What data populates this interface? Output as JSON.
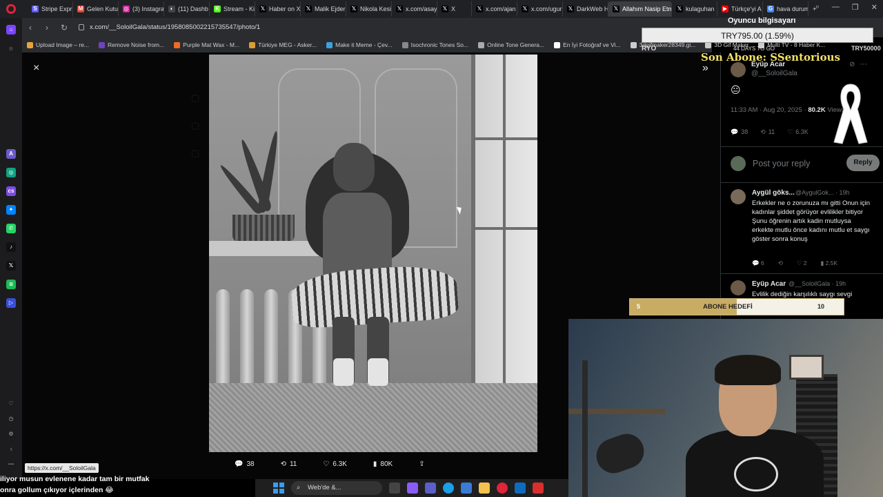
{
  "browser": {
    "tabs": [
      {
        "label": "Stripe Expr",
        "color": "#635bff",
        "glyph": "S"
      },
      {
        "label": "Gelen Kutu",
        "color": "#ea4335",
        "glyph": "M"
      },
      {
        "label": "(3) Instagra",
        "color": "#d6249f",
        "glyph": "◎"
      },
      {
        "label": "(11) Dashb",
        "color": "#444444",
        "glyph": "◐"
      },
      {
        "label": "Stream - Ki",
        "color": "#53fc18",
        "glyph": "K"
      },
      {
        "label": "Haber on X",
        "color": "#000000",
        "glyph": "𝕏"
      },
      {
        "label": "Malik Ejder",
        "color": "#000000",
        "glyph": "𝕏"
      },
      {
        "label": "Nikola Kesi",
        "color": "#000000",
        "glyph": "𝕏"
      },
      {
        "label": "x.com/asay",
        "color": "#000000",
        "glyph": "𝕏"
      },
      {
        "label": "X",
        "color": "#000000",
        "glyph": "𝕏"
      },
      {
        "label": "x.com/ajan",
        "color": "#000000",
        "glyph": "𝕏"
      },
      {
        "label": "x.com/ugur",
        "color": "#000000",
        "glyph": "𝕏"
      },
      {
        "label": "DarkWeb H",
        "color": "#000000",
        "glyph": "𝕏"
      },
      {
        "label": "Allahım Nasip Etme",
        "color": "#000000",
        "glyph": "𝕏",
        "active": true
      },
      {
        "label": "kulaguhan",
        "color": "#000000",
        "glyph": "𝕏"
      },
      {
        "label": "Türkçe'yi A",
        "color": "#ff0000",
        "glyph": "▶"
      },
      {
        "label": "hava durum",
        "color": "#4285f4",
        "glyph": "G"
      }
    ],
    "new_tab_label": "+",
    "url": "x.com/__SoloilGala/status/1958085002215735547/photo/1",
    "bookmarks": [
      {
        "label": "Upload Image – re...",
        "color": "#e8a33a"
      },
      {
        "label": "Remove Noise from...",
        "color": "#6f42c1"
      },
      {
        "label": "Purple Mat Wax - M...",
        "color": "#f06a24"
      },
      {
        "label": "Türkiye MEG - Asker...",
        "color": "#d9a036"
      },
      {
        "label": "Make it Meme - Çev...",
        "color": "#3aa2e0"
      },
      {
        "label": "Isochronic Tones So...",
        "color": "#888888"
      },
      {
        "label": "Online Tone Genera...",
        "color": "#aaaaaa"
      },
      {
        "label": "En İyi Fotoğraf ve Vi...",
        "color": "#ffffff"
      },
      {
        "label": "3dgifmaker28349.gi...",
        "color": "#cccccc"
      },
      {
        "label": "3D Gif Maker",
        "color": "#cccccc"
      },
      {
        "label": "Multi TV - 8 Haber K...",
        "color": "#cccccc"
      }
    ]
  },
  "photo_viewer": {
    "close_label": "×",
    "expand_label": "»",
    "actions": [
      {
        "name": "reply",
        "icon": "💬",
        "count": "38"
      },
      {
        "name": "repost",
        "icon": "⟲",
        "count": "11"
      },
      {
        "name": "like",
        "icon": "♡",
        "count": "6.3K"
      },
      {
        "name": "views",
        "icon": "▮",
        "count": "80K"
      },
      {
        "name": "share",
        "icon": "⇪",
        "count": ""
      }
    ]
  },
  "tweet": {
    "author": "Eyüp Acar",
    "handle": "@__SoloilGala",
    "emoji": "😐",
    "time": "11:33 AM · Aug 20, 2025 · ",
    "views": "80.2K",
    "views_label": " Views",
    "stats": [
      {
        "icon": "💬",
        "count": "38"
      },
      {
        "icon": "⟲",
        "count": "11"
      },
      {
        "icon": "♡",
        "count": "6.3K"
      }
    ],
    "reply_placeholder": "Post your reply",
    "reply_button": "Reply"
  },
  "replies": [
    {
      "author": "Aygül göks...",
      "handle": "@AygulGok... · 19h",
      "text": "Erkekler ne o zorunuza mı gitti Onun için kadınlar şiddet görüyor evlilikler bitiyor Şunu öğrenin artık kadin mutluysa erkekte mutlu önce kadını mutlu et saygı göster sonra konuş",
      "stats": [
        "6",
        "",
        "2",
        "2.5K"
      ]
    },
    {
      "author": "Eyüp Acar",
      "handle": "@__SoloilGala · 19h",
      "text": "Evlilik dediğin karşılıklı saygı sevgi hoşgörüden oluşur. Siz neyi savunduğunuzun farkında bile"
    }
  ],
  "overlay": {
    "name": "Oyuncu bilgisayarı",
    "price": "TRY795.00 (1.59%)",
    "goal_left": "RYO",
    "goal_right": "TRY50000",
    "days_left": "44 DAYS TO GO",
    "sub_text": "Son Abone: SSentorious",
    "sub_goal": {
      "label": "ABONE HEDEFİ",
      "min": "5",
      "max": "10",
      "progress": 0.5
    }
  },
  "chat": {
    "line1": "iliyor musun evlenene kadar tam bir mutfak",
    "line2": "onra gollum çıkıyor içlerinden 😂"
  },
  "status_tip": "https://x.com/__SoloilGala",
  "taskbar": {
    "search": "Web'de &..."
  }
}
